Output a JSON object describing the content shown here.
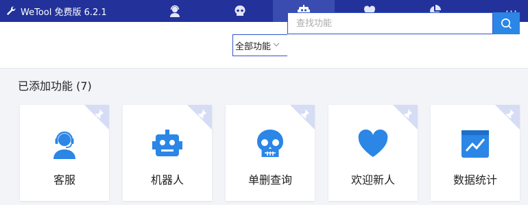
{
  "titlebar": {
    "app_title": "WeTool 免费版 6.2.1",
    "menu_label": "···",
    "tabs": [
      {
        "icon": "headset-user-icon",
        "active": false
      },
      {
        "icon": "skull-icon",
        "active": false
      },
      {
        "icon": "robot-icon",
        "active": true
      },
      {
        "icon": "heart-icon",
        "active": false
      },
      {
        "icon": "pie-chart-icon",
        "active": false
      }
    ]
  },
  "toolbar": {
    "filter_value": "全部功能",
    "search_placeholder": "查找功能"
  },
  "section": {
    "title": "已添加功能 (7)"
  },
  "features": [
    {
      "label": "客服",
      "icon": "customer-service-icon"
    },
    {
      "label": "机器人",
      "icon": "robot-icon"
    },
    {
      "label": "单删查询",
      "icon": "skull-icon"
    },
    {
      "label": "欢迎新人",
      "icon": "heart-icon"
    },
    {
      "label": "数据统计",
      "icon": "line-chart-icon"
    }
  ],
  "colors": {
    "titlebar": "#22329a",
    "active_tab": "#3a4cb0",
    "accent": "#2b86e6",
    "pin_corner": "#d7dcf5"
  }
}
